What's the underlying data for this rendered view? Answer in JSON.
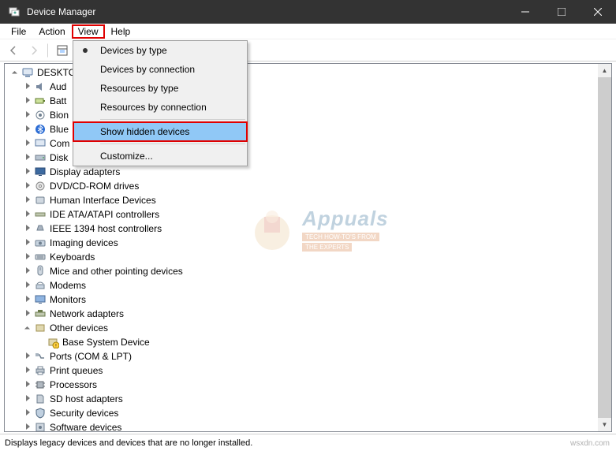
{
  "title": "Device Manager",
  "menu": {
    "file": "File",
    "action": "Action",
    "view": "View",
    "help": "Help"
  },
  "ctx": {
    "devices_type": "Devices by type",
    "devices_conn": "Devices by connection",
    "res_type": "Resources by type",
    "res_conn": "Resources by connection",
    "show_hidden": "Show hidden devices",
    "customize": "Customize..."
  },
  "root": "DESKTO",
  "nodes": {
    "aud": "Aud",
    "batt": "Batt",
    "bion": "Bion",
    "blue": "Blue",
    "com": "Com",
    "disk": "Disk",
    "display": "Display adapters",
    "dvd": "DVD/CD-ROM drives",
    "hid": "Human Interface Devices",
    "ide": "IDE ATA/ATAPI controllers",
    "ieee": "IEEE 1394 host controllers",
    "imaging": "Imaging devices",
    "keyboards": "Keyboards",
    "mice": "Mice and other pointing devices",
    "modems": "Modems",
    "monitors": "Monitors",
    "network": "Network adapters",
    "other": "Other devices",
    "base_system": "Base System Device",
    "ports": "Ports (COM & LPT)",
    "print": "Print queues",
    "processors": "Processors",
    "sdhost": "SD host adapters",
    "security": "Security devices",
    "software": "Software devices"
  },
  "status": "Displays legacy devices and devices that are no longer installed.",
  "watermark": "wsxdn.com",
  "logo": {
    "name": "Appuals",
    "tag1": "TECH HOW-TO'S FROM",
    "tag2": "THE EXPERTS"
  }
}
